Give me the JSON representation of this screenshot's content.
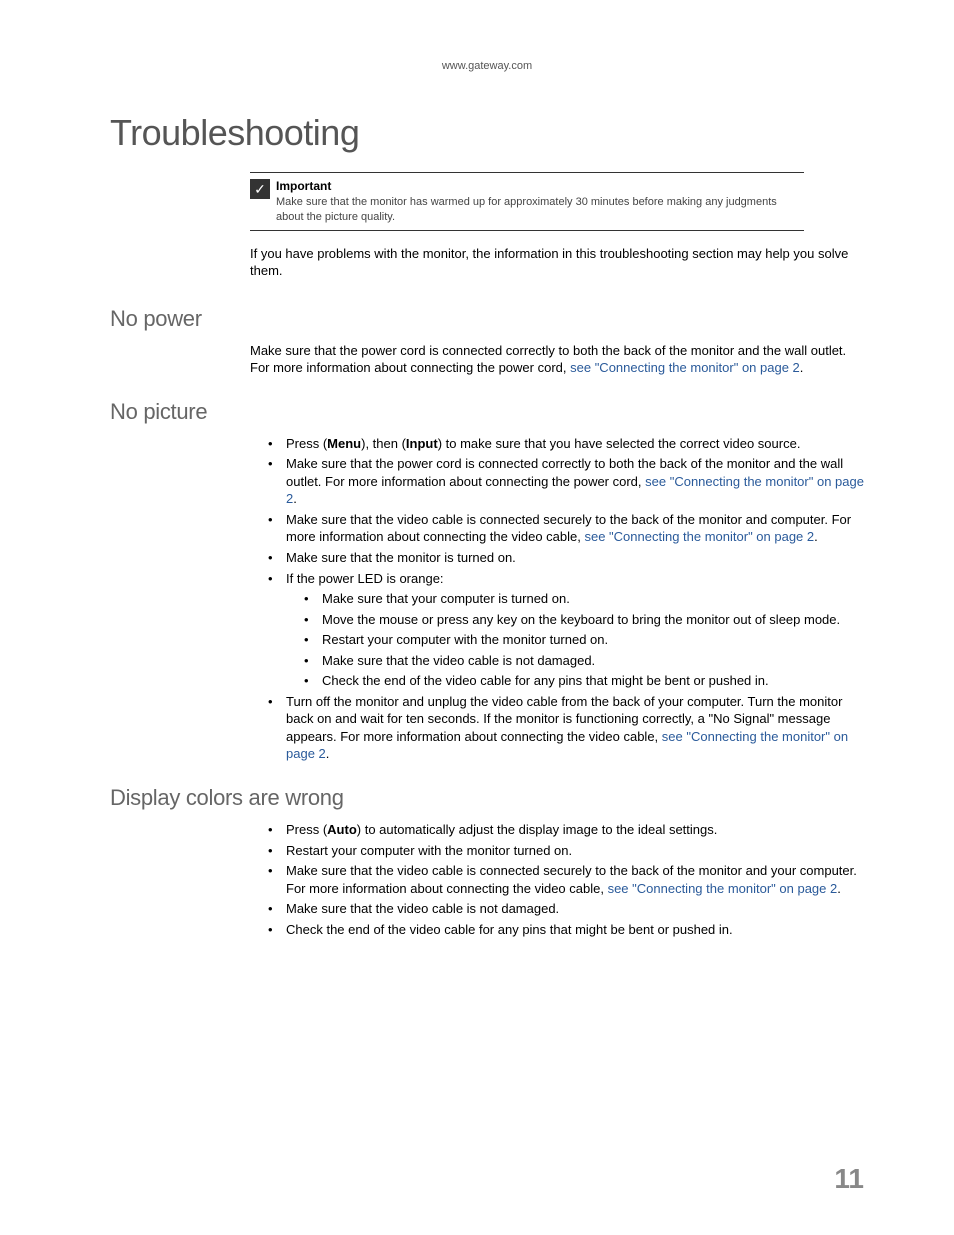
{
  "header": {
    "url": "www.gateway.com"
  },
  "title": "Troubleshooting",
  "important": {
    "label": "Important",
    "text": "Make sure that the monitor has warmed up for approximately 30 minutes before making any judgments about the picture quality."
  },
  "intro": "If you have problems with the monitor, the information in this troubleshooting section may help you solve them.",
  "sections": {
    "no_power": {
      "title": "No power",
      "body_pre": "Make sure that the power cord is connected correctly to both the back of the monitor and the wall outlet. For more information about connecting the power cord, ",
      "link": "see \"Connecting the monitor\" on page 2",
      "body_post": "."
    },
    "no_picture": {
      "title": "No picture",
      "item1_pre": "Press (",
      "item1_b1": "Menu",
      "item1_mid": "), then (",
      "item1_b2": "Input",
      "item1_post": ") to make sure that you have selected the correct video source.",
      "item2_pre": "Make sure that the power cord is connected correctly to both the back of the monitor and the wall outlet. For more information about connecting the power cord, ",
      "item2_link": "see \"Connecting the monitor\" on page 2",
      "item2_post": ".",
      "item3_pre": "Make sure that the video cable is connected securely to the back of the monitor and computer. For more information about connecting the video cable, ",
      "item3_link": "see \"Connecting the monitor\" on page 2",
      "item3_post": ".",
      "item4": "Make sure that the monitor is turned on.",
      "item5": "If the power LED is orange:",
      "sub1": "Make sure that your computer is turned on.",
      "sub2": "Move the mouse or press any key on the keyboard to bring the monitor out of sleep mode.",
      "sub3": "Restart your computer with the monitor turned on.",
      "sub4": "Make sure that the video cable is not damaged.",
      "sub5": "Check the end of the video cable for any pins that might be bent or pushed in.",
      "item6_pre": "Turn off the monitor and unplug the video cable from the back of your computer. Turn the monitor back on and wait for ten seconds. If the monitor is functioning correctly, a \"No Signal\" message appears. For more information about connecting the video cable, ",
      "item6_link": "see \"Connecting the monitor\" on page 2",
      "item6_post": "."
    },
    "display_colors": {
      "title": "Display colors are wrong",
      "item1_pre": "Press (",
      "item1_b": "Auto",
      "item1_post": ") to automatically adjust the display image to the ideal settings.",
      "item2": "Restart your computer with the monitor turned on.",
      "item3_pre": "Make sure that the video cable is connected securely to the back of the monitor and your computer. For more information about connecting the video cable, ",
      "item3_link": "see \"Connecting the monitor\" on page 2",
      "item3_post": ".",
      "item4": "Make sure that the video cable is not damaged.",
      "item5": "Check the end of the video cable for any pins that might be bent or pushed in."
    }
  },
  "page_number": "11"
}
